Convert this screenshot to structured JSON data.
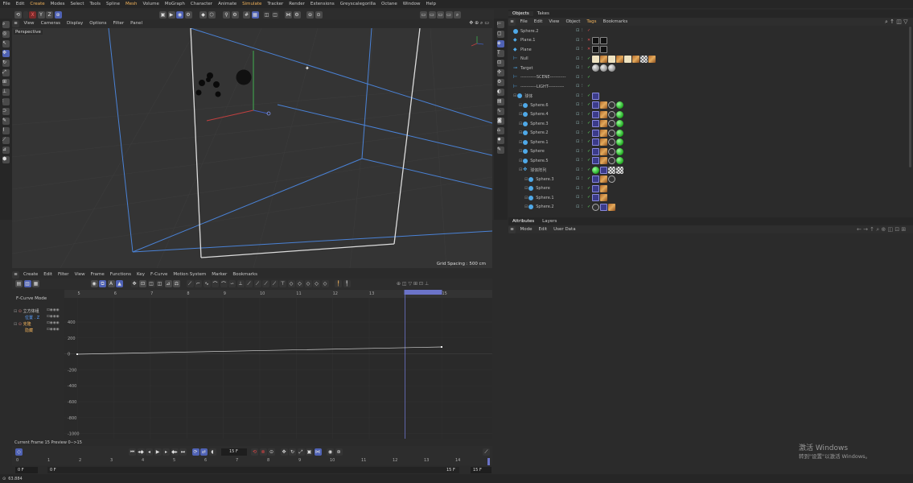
{
  "menu": [
    "File",
    "Edit",
    "Create",
    "Modes",
    "Select",
    "Tools",
    "Spline",
    "Mesh",
    "Volume",
    "MoGraph",
    "Character",
    "Animate",
    "Simulate",
    "Tracker",
    "Render",
    "Extensions",
    "Greyscalegorilla",
    "Octane",
    "Window",
    "Help"
  ],
  "axis_buttons": [
    "X",
    "Y",
    "Z"
  ],
  "viewport": {
    "menu": [
      "View",
      "Cameras",
      "Display",
      "Options",
      "Filter",
      "Panel"
    ],
    "label": "Perspective",
    "grid_spacing": "Grid Spacing : 500 cm"
  },
  "object_manager": {
    "tabs": [
      "Objects",
      "Takes"
    ],
    "menu": [
      "File",
      "Edit",
      "View",
      "Object",
      "Tags",
      "Bookmarks"
    ],
    "objects": [
      {
        "name": "Sphere.2",
        "icon": "sphere",
        "indent": 0,
        "tags": []
      },
      {
        "name": "Plane.1",
        "icon": "plane",
        "indent": 0,
        "tags": [
          "dark",
          "dark"
        ]
      },
      {
        "name": "Plane",
        "icon": "plane",
        "indent": 0,
        "tags": [
          "dark",
          "dark"
        ]
      },
      {
        "name": "Null",
        "icon": "null",
        "indent": 0,
        "tags": [
          "cream",
          "wood",
          "cream",
          "wood",
          "cream",
          "wood",
          "chk",
          "wood"
        ]
      },
      {
        "name": "Target",
        "icon": "target",
        "indent": 0,
        "tags": [
          "gray",
          "gray",
          "gray"
        ]
      },
      {
        "name": "-----------SCENE-----------",
        "icon": "null",
        "indent": 0,
        "tags": []
      },
      {
        "name": "-----------LIGHT-----------",
        "icon": "null",
        "indent": 0,
        "tags": []
      },
      {
        "name": "球体",
        "icon": "sphere",
        "indent": 0,
        "tags": [
          "ph"
        ]
      },
      {
        "name": "Sphere.6",
        "icon": "sphere",
        "indent": 1,
        "tags": [
          "ph",
          "wood",
          "eye",
          "grn"
        ]
      },
      {
        "name": "Sphere.4",
        "icon": "sphere",
        "indent": 1,
        "tags": [
          "ph",
          "wood",
          "eye",
          "grn"
        ]
      },
      {
        "name": "Sphere.3",
        "icon": "sphere",
        "indent": 1,
        "tags": [
          "ph",
          "wood",
          "eye",
          "grn"
        ]
      },
      {
        "name": "Sphere.2",
        "icon": "sphere",
        "indent": 1,
        "tags": [
          "ph",
          "wood",
          "eye",
          "grn"
        ]
      },
      {
        "name": "Sphere.1",
        "icon": "sphere",
        "indent": 1,
        "tags": [
          "ph",
          "wood",
          "eye",
          "grn"
        ]
      },
      {
        "name": "Sphere",
        "icon": "sphere",
        "indent": 1,
        "tags": [
          "ph",
          "wood",
          "eye",
          "grn"
        ]
      },
      {
        "name": "Sphere.5",
        "icon": "sphere",
        "indent": 1,
        "tags": [
          "ph",
          "wood",
          "eye",
          "grn"
        ]
      },
      {
        "name": "球体阵列",
        "icon": "array",
        "indent": 1,
        "tags": [
          "grn",
          "ph",
          "chk",
          "chk"
        ]
      },
      {
        "name": "Sphere.3",
        "icon": "sphere",
        "indent": 2,
        "tags": [
          "ph",
          "wood",
          "eye"
        ]
      },
      {
        "name": "Sphere",
        "icon": "sphere",
        "indent": 2,
        "tags": [
          "ph",
          "wood"
        ]
      },
      {
        "name": "Sphere.1",
        "icon": "sphere",
        "indent": 2,
        "tags": [
          "ph",
          "wood"
        ]
      },
      {
        "name": "Sphere.2",
        "icon": "sphere",
        "indent": 2,
        "tags": [
          "eye",
          "ph",
          "wood"
        ]
      }
    ]
  },
  "attributes": {
    "tabs": [
      "Attributes",
      "Layers"
    ],
    "menu": [
      "Mode",
      "Edit",
      "User Data"
    ]
  },
  "timeline": {
    "menu": [
      "Create",
      "Edit",
      "Filter",
      "View",
      "Frame",
      "Functions",
      "Key",
      "F-Curve",
      "Motion System",
      "Marker",
      "Bookmarks"
    ],
    "mode_label": "F-Curve Mode",
    "tracks": [
      {
        "name": "立方体组",
        "color": "#c8c8c8"
      },
      {
        "name": "位置 . Z",
        "color": "#5aa0ff"
      },
      {
        "name": "克隆",
        "color": "#f2b35b"
      },
      {
        "name": "隐藏",
        "color": "#f2b35b"
      }
    ],
    "top_ticks": [
      "5",
      "6",
      "7",
      "8",
      "9",
      "10",
      "11",
      "12",
      "13",
      "14",
      "15"
    ],
    "y_ticks": [
      "400",
      "200",
      "0",
      "-200",
      "-400",
      "-600",
      "-800",
      "-1000"
    ],
    "status": "Current Frame  15  Preview  0-->15",
    "frame_field": "15 F",
    "bottom_ticks": [
      "0",
      "1",
      "2",
      "3",
      "4",
      "5",
      "6",
      "7",
      "8",
      "9",
      "10",
      "11",
      "12",
      "13",
      "14"
    ],
    "start_frame": "0 F",
    "min_frame": "0 F",
    "max_frame": "15 F",
    "end_frame": "15 F"
  },
  "bottom_status": "63.884",
  "watermark": {
    "line1": "激活 Windows",
    "line2": "转到\"设置\"以激活 Windows。"
  }
}
